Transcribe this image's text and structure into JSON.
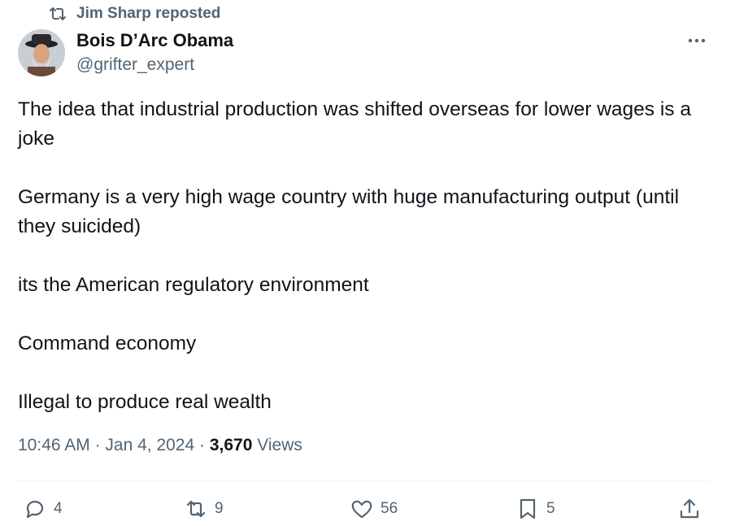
{
  "repost": {
    "label": "Jim Sharp reposted",
    "icon": "repost-icon"
  },
  "author": {
    "name": "Bois D’Arc Obama",
    "handle": "@grifter_expert"
  },
  "tweet": {
    "lines": [
      "The idea that industrial production was shifted overseas for lower wages is a joke",
      "Germany is a very high wage country with huge manufacturing output (until they suicided)",
      "its the American regulatory environment",
      "Command economy",
      "Illegal to produce real wealth"
    ],
    "time": "10:46 AM",
    "date": "Jan 4, 2024",
    "views_count": "3,670",
    "views_label": "Views"
  },
  "actions": {
    "replies": "4",
    "reposts": "9",
    "likes": "56",
    "bookmarks": "5"
  },
  "colors": {
    "text": "#0f1419",
    "secondary": "#536471",
    "divider": "#eff3f4"
  }
}
